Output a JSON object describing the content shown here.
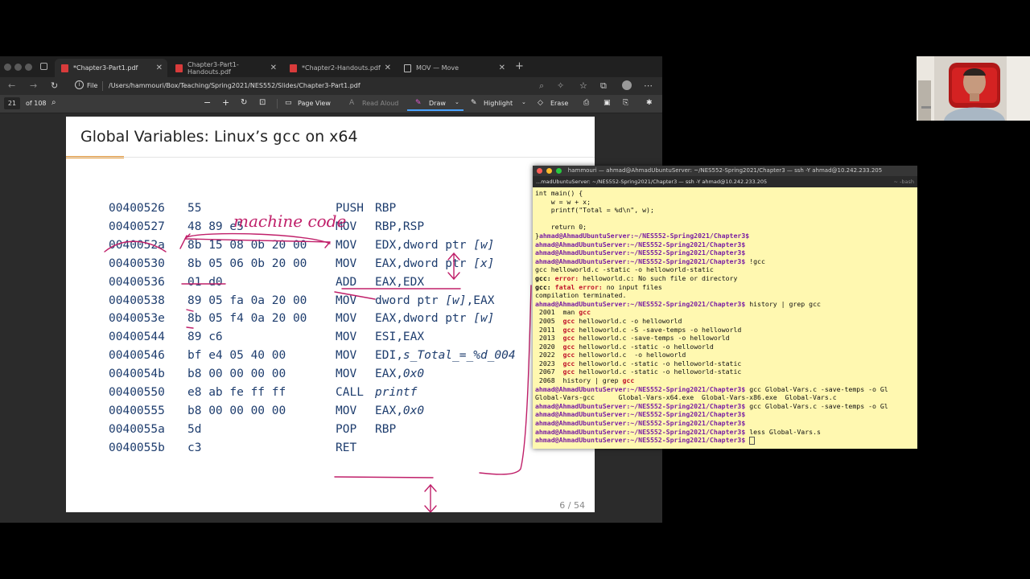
{
  "browser": {
    "tabs": [
      {
        "label": "*Chapter3-Part1.pdf",
        "active": true
      },
      {
        "label": "Chapter3-Part1-Handouts.pdf",
        "active": false
      },
      {
        "label": "*Chapter2-Handouts.pdf",
        "active": false
      },
      {
        "label": "MOV — Move",
        "active": false
      }
    ],
    "address": {
      "file_label": "File",
      "url": "/Users/hammouri/Box/Teaching/Spring2021/NES552/Slides/Chapter3-Part1.pdf"
    },
    "pdf_toolbar": {
      "page_current": "21",
      "page_total": "of 108",
      "page_view": "Page View",
      "read_aloud": "Read Aloud",
      "draw": "Draw",
      "highlight": "Highlight",
      "erase": "Erase"
    }
  },
  "slide": {
    "title_prefix": "Global Variables: Linux’s",
    "title_code": "gcc",
    "title_suffix": "on x64",
    "annotation": "machine code",
    "rows": [
      {
        "addr": "00400526",
        "bytes": "55",
        "op": "PUSH",
        "arg": "RBP"
      },
      {
        "addr": "00400527",
        "bytes": "48 89 e5",
        "op": "MOV",
        "arg": "RBP,RSP"
      },
      {
        "addr": "0040052a",
        "bytes": "8b 15 08 0b 20 00",
        "op": "MOV",
        "arg": "EDX,dword ptr [w]"
      },
      {
        "addr": "00400530",
        "bytes": "8b 05 06 0b 20 00",
        "op": "MOV",
        "arg": "EAX,dword ptr [x]"
      },
      {
        "addr": "00400536",
        "bytes": "01 d0",
        "op": "ADD",
        "arg": "EAX,EDX"
      },
      {
        "addr": "00400538",
        "bytes": "89 05 fa 0a 20 00",
        "op": "MOV",
        "arg": "dword ptr [w],EAX"
      },
      {
        "addr": "0040053e",
        "bytes": "8b 05 f4 0a 20 00",
        "op": "MOV",
        "arg": "EAX,dword ptr [w]"
      },
      {
        "addr": "00400544",
        "bytes": "89 c6",
        "op": "MOV",
        "arg": "ESI,EAX"
      },
      {
        "addr": "00400546",
        "bytes": "bf e4 05 40 00",
        "op": "MOV",
        "arg": "EDI,s_Total_=_%d_004"
      },
      {
        "addr": "0040054b",
        "bytes": "b8 00 00 00 00",
        "op": "MOV",
        "arg": "EAX,0x0"
      },
      {
        "addr": "00400550",
        "bytes": "e8 ab fe ff ff",
        "op": "CALL",
        "arg": "printf"
      },
      {
        "addr": "00400555",
        "bytes": "b8 00 00 00 00",
        "op": "MOV",
        "arg": "EAX,0x0"
      },
      {
        "addr": "0040055a",
        "bytes": "5d",
        "op": "POP",
        "arg": "RBP"
      },
      {
        "addr": "0040055b",
        "bytes": "c3",
        "op": "RET",
        "arg": ""
      }
    ],
    "page_number": "6 / 54"
  },
  "terminal": {
    "title": "hammouri — ahmad@AhmadUbuntuServer: ~/NES552-Spring2021/Chapter3 — ssh -Y ahmad@10.242.233.205",
    "tab_label": "...madUbuntuServer: ~/NES552-Spring2021/Chapter3 — ssh -Y ahmad@10.242.233.205",
    "tab_right": "~ -bash",
    "prompt": "ahmad@AhmadUbuntuServer:~/NES552-Spring2021/Chapter3$",
    "lines": [
      {
        "kind": "plain",
        "text": "int main() {"
      },
      {
        "kind": "plain",
        "text": "    w = w + x;"
      },
      {
        "kind": "plain",
        "text": "    printf(\"Total = %d\\n\", w);"
      },
      {
        "kind": "plain",
        "text": ""
      },
      {
        "kind": "plain",
        "text": "    return 0;"
      },
      {
        "kind": "prompt_after",
        "pre": "}",
        "cmd": ""
      },
      {
        "kind": "prompt",
        "cmd": ""
      },
      {
        "kind": "prompt",
        "cmd": ""
      },
      {
        "kind": "prompt",
        "cmd": " !gcc"
      },
      {
        "kind": "plain",
        "text": "gcc helloworld.c -static -o helloworld-static"
      },
      {
        "kind": "err",
        "tag": "gcc:",
        "red": "error:",
        "text": " helloworld.c: No such file or directory"
      },
      {
        "kind": "err",
        "tag": "gcc:",
        "red": "fatal error:",
        "text": " no input files"
      },
      {
        "kind": "plain",
        "text": "compilation terminated."
      },
      {
        "kind": "prompt",
        "cmd": " history | grep gcc"
      },
      {
        "kind": "hist",
        "num": " 2001",
        "pre": "  man ",
        "g": "gcc",
        "rest": ""
      },
      {
        "kind": "hist",
        "num": " 2005",
        "pre": "  ",
        "g": "gcc",
        "rest": " helloworld.c -o helloworld"
      },
      {
        "kind": "hist",
        "num": " 2011",
        "pre": "  ",
        "g": "gcc",
        "rest": " helloworld.c -S -save-temps -o helloworld"
      },
      {
        "kind": "hist",
        "num": " 2013",
        "pre": "  ",
        "g": "gcc",
        "rest": " helloworld.c -save-temps -o helloworld"
      },
      {
        "kind": "hist",
        "num": " 2020",
        "pre": "  ",
        "g": "gcc",
        "rest": " helloworld.c -static -o helloworld"
      },
      {
        "kind": "hist",
        "num": " 2022",
        "pre": "  ",
        "g": "gcc",
        "rest": " helloworld.c  -o helloworld"
      },
      {
        "kind": "hist",
        "num": " 2023",
        "pre": "  ",
        "g": "gcc",
        "rest": " helloworld.c -static -o helloworld-static"
      },
      {
        "kind": "hist",
        "num": " 2067",
        "pre": "  ",
        "g": "gcc",
        "rest": " helloworld.c -static -o helloworld-static"
      },
      {
        "kind": "hist",
        "num": " 2068",
        "pre": "  history | grep ",
        "g": "gcc",
        "rest": ""
      },
      {
        "kind": "prompt",
        "cmd": " gcc Global-Vars.c -save-temps -o Gl"
      },
      {
        "kind": "plain",
        "text": "Global-Vars-gcc      Global-Vars-x64.exe  Global-Vars-x86.exe  Global-Vars.c"
      },
      {
        "kind": "prompt",
        "cmd": " gcc Global-Vars.c -save-temps -o Gl"
      },
      {
        "kind": "prompt",
        "cmd": ""
      },
      {
        "kind": "prompt",
        "cmd": ""
      },
      {
        "kind": "prompt",
        "cmd": " less Global-Vars.s"
      },
      {
        "kind": "prompt_cursor",
        "cmd": " "
      }
    ]
  },
  "colors": {
    "slide_text": "#1e3d6e",
    "ink": "#c0206a",
    "accent": "#e79b3c",
    "terminal_bg": "#fff8b0",
    "prompt": "#7a1fa2"
  }
}
